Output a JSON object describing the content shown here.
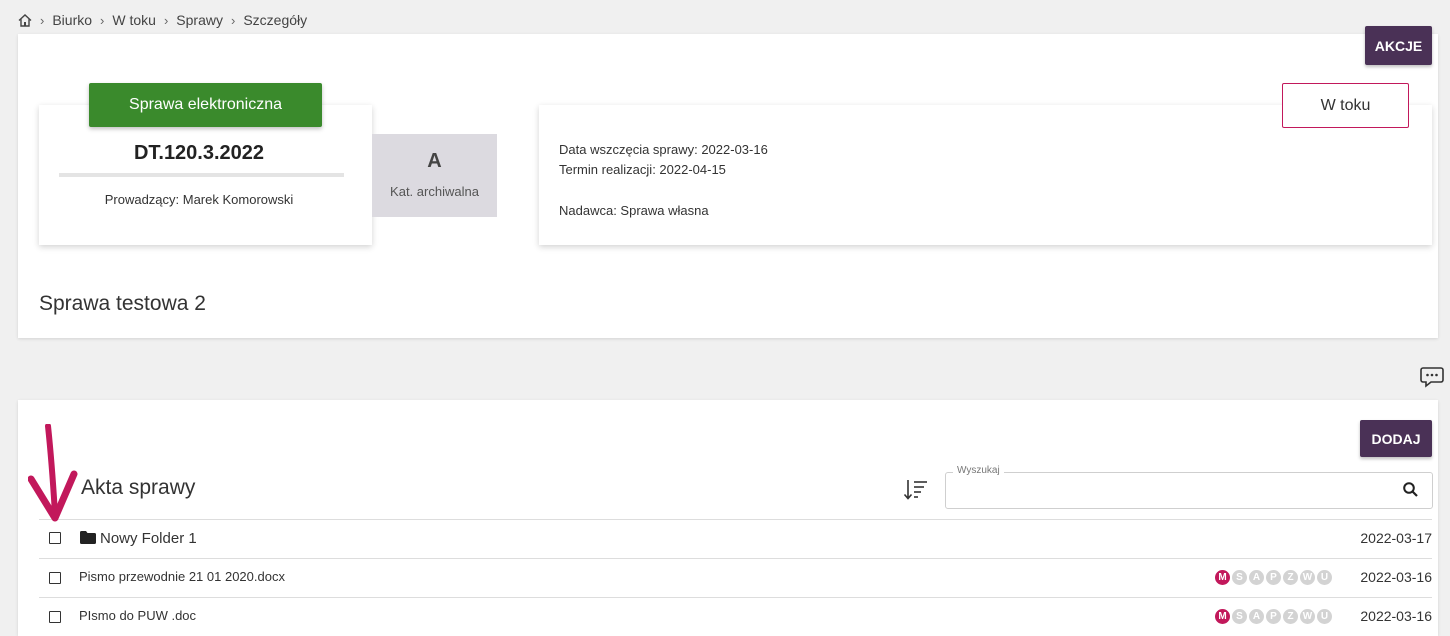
{
  "breadcrumb": {
    "items": [
      "Biurko",
      "W toku",
      "Sprawy",
      "Szczegóły"
    ]
  },
  "header": {
    "actions_label": "AKCJE"
  },
  "case": {
    "type_badge": "Sprawa elektroniczna",
    "number": "DT.120.3.2022",
    "lead": "Prowadzący: Marek Komorowski",
    "archive_category": "A",
    "archive_label": "Kat. archiwalna",
    "status": "W toku",
    "start_date": "Data wszczęcia sprawy:  2022-03-16",
    "deadline": "Termin realizacji:  2022-04-15",
    "sender": "Nadawca: Sprawa własna",
    "title": "Sprawa testowa 2"
  },
  "files": {
    "add_label": "DODAJ",
    "title": "Akta sprawy",
    "search": {
      "legend": "Wyszukaj",
      "value": "",
      "placeholder": ""
    },
    "rows": [
      {
        "name": "Nowy Folder 1",
        "date": "2022-03-17",
        "kind": "folder"
      },
      {
        "name": "Pismo przewodnie 21 01 2020.docx",
        "date": "2022-03-16",
        "kind": "file",
        "flags": [
          "M",
          "S",
          "A",
          "P",
          "Z",
          "W",
          "U"
        ]
      },
      {
        "name": "PIsmo do PUW .doc",
        "date": "2022-03-16",
        "kind": "file",
        "flags": [
          "M",
          "S",
          "A",
          "P",
          "Z",
          "W",
          "U"
        ]
      }
    ]
  },
  "colors": {
    "purple": "#4a3156",
    "green": "#3a8a2c",
    "magenta": "#c2185b",
    "arrow": "#c2185b"
  },
  "icons": {
    "home": "home-icon",
    "chat": "chat-icon",
    "sort": "sort-icon",
    "search": "search-icon",
    "folder": "folder-icon",
    "arrow": "arrow-down-icon"
  }
}
